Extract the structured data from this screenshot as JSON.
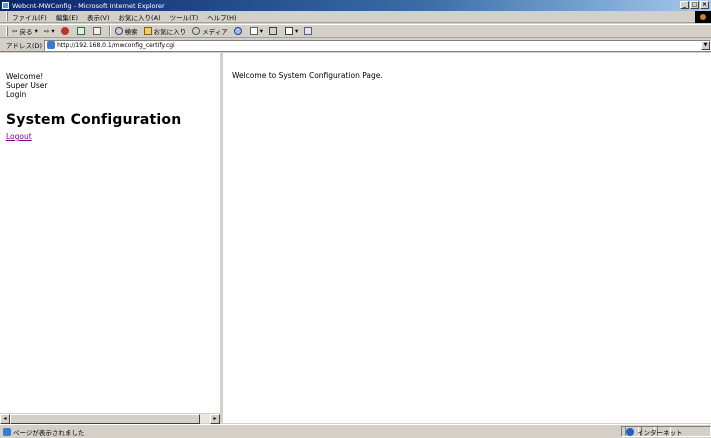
{
  "window": {
    "title": "Webcnt-MWConfig - Microsoft Internet Explorer",
    "controls": [
      "_",
      "□",
      "×"
    ]
  },
  "menubar": {
    "items": [
      "ファイル(F)",
      "編集(E)",
      "表示(V)",
      "お気に入り(A)",
      "ツール(T)",
      "ヘルプ(H)"
    ]
  },
  "toolbar": {
    "back_label": "戻る",
    "search_label": "検索",
    "favorites_label": "お気に入り",
    "media_label": "メディア"
  },
  "address": {
    "label": "アドレス(D)",
    "url": "http://192.168.0.1/mwconfig_certify.cgi"
  },
  "left_frame": {
    "welcome": "Welcome!",
    "user": "Super User",
    "login": "Login",
    "heading": "System Configuration",
    "logout_link": "Logout"
  },
  "right_frame": {
    "message": "Welcome to System Configuration Page."
  },
  "statusbar": {
    "text": "ページが表示されました",
    "zone": "インターネット"
  }
}
